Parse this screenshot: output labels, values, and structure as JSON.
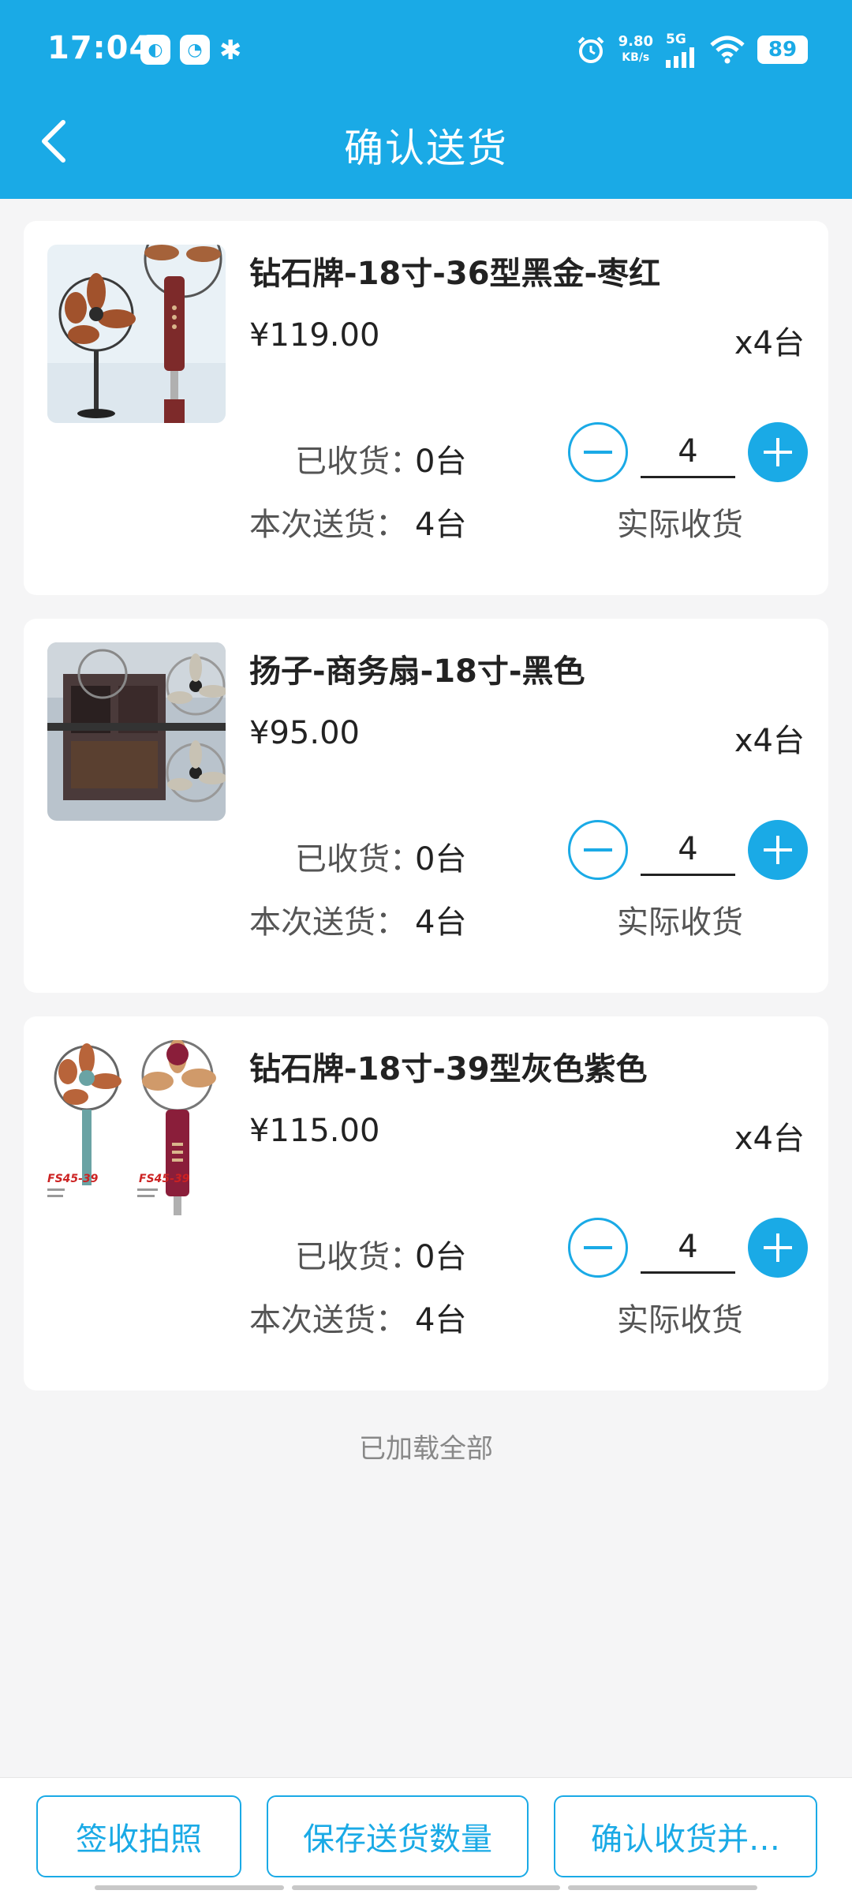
{
  "status_bar": {
    "time": "17:04",
    "net_speed_value": "9.80",
    "net_speed_unit": "KB/s",
    "network_type": "5G",
    "battery": "89"
  },
  "header": {
    "title": "确认送货"
  },
  "labels": {
    "received": "已收货：",
    "this_delivery": "本次送货：",
    "actual_received": "实际收货"
  },
  "items": [
    {
      "name": "钻石牌-18寸-36型黑金-枣红",
      "price": "¥119.00",
      "qty": "x4台",
      "received": "0台",
      "delivered": "4台",
      "actual": "4"
    },
    {
      "name": "扬子-商务扇-18寸-黑色",
      "price": "¥95.00",
      "qty": "x4台",
      "received": "0台",
      "delivered": "4台",
      "actual": "4"
    },
    {
      "name": "钻石牌-18寸-39型灰色紫色",
      "price": "¥115.00",
      "qty": "x4台",
      "received": "0台",
      "delivered": "4台",
      "actual": "4"
    }
  ],
  "image_text": {
    "model_left": "FS45-39",
    "model_right": "FS45-39"
  },
  "footer_text": "已加载全部",
  "bottom_buttons": {
    "sign_photo": "签收拍照",
    "save_qty": "保存送货数量",
    "confirm": "确认收货并…"
  },
  "colors": {
    "primary": "#1aaae6",
    "background": "#f5f5f6"
  }
}
